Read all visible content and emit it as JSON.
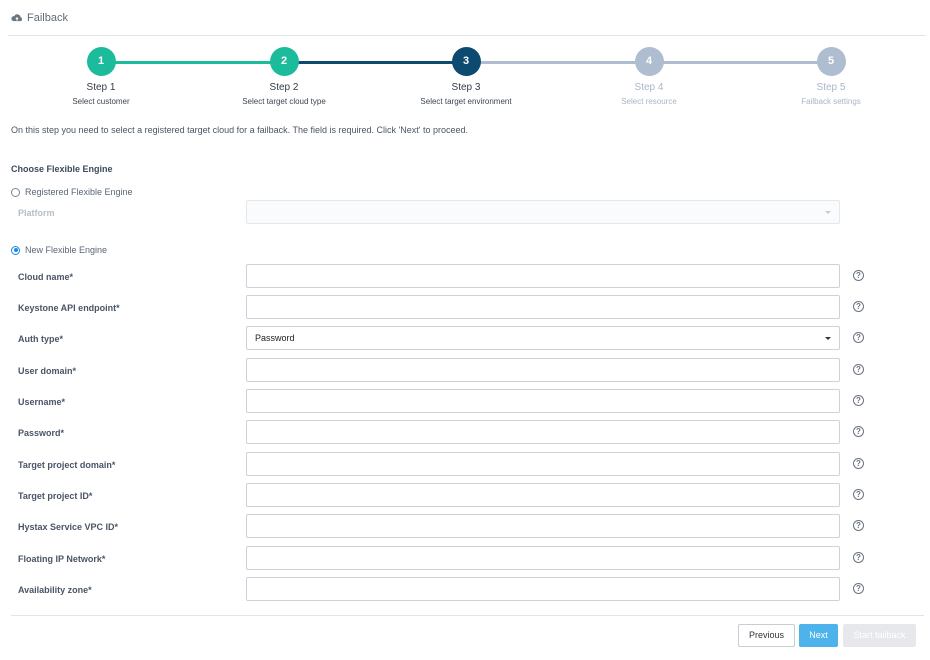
{
  "header": {
    "title": "Failback",
    "icon": "cloud-upload-icon"
  },
  "wizard": {
    "steps": [
      {
        "number": "1",
        "title": "Step 1",
        "subtitle": "Select customer",
        "status": "completed"
      },
      {
        "number": "2",
        "title": "Step 2",
        "subtitle": "Select target cloud type",
        "status": "completed"
      },
      {
        "number": "3",
        "title": "Step 3",
        "subtitle": "Select target environment",
        "status": "current"
      },
      {
        "number": "4",
        "title": "Step 4",
        "subtitle": "Select resource",
        "status": "pending"
      },
      {
        "number": "5",
        "title": "Step 5",
        "subtitle": "Failback settings",
        "status": "pending"
      }
    ],
    "colors": {
      "completed": "#1cbb9c",
      "current": "#0d4a70",
      "pending": "#aebdd0"
    }
  },
  "intro": "On this step you need to select a registered target cloud for a failback. The field is required. Click 'Next' to proceed.",
  "section_title": "Choose Flexible Engine",
  "options": {
    "registered": {
      "label": "Registered Flexible Engine",
      "selected": false
    },
    "new": {
      "label": "New Flexible Engine",
      "selected": true
    }
  },
  "platform": {
    "label": "Platform",
    "value": ""
  },
  "fields": [
    {
      "label": "Cloud name*",
      "value": "",
      "type": "text"
    },
    {
      "label": "Keystone API endpoint*",
      "value": "",
      "type": "text"
    },
    {
      "label": "Auth type*",
      "value": "Password",
      "type": "select"
    },
    {
      "label": "User domain*",
      "value": "",
      "type": "text"
    },
    {
      "label": "Username*",
      "value": "",
      "type": "text"
    },
    {
      "label": "Password*",
      "value": "",
      "type": "text"
    },
    {
      "label": "Target project domain*",
      "value": "",
      "type": "text"
    },
    {
      "label": "Target project ID*",
      "value": "",
      "type": "text"
    },
    {
      "label": "Hystax Service VPC ID*",
      "value": "",
      "type": "text"
    },
    {
      "label": "Floating IP Network*",
      "value": "",
      "type": "text"
    },
    {
      "label": "Availability zone*",
      "value": "",
      "type": "text"
    }
  ],
  "help_icon": "question-circle-icon",
  "help_glyph": "?",
  "buttons": {
    "previous": "Previous",
    "next": "Next",
    "start": "Start failback"
  }
}
